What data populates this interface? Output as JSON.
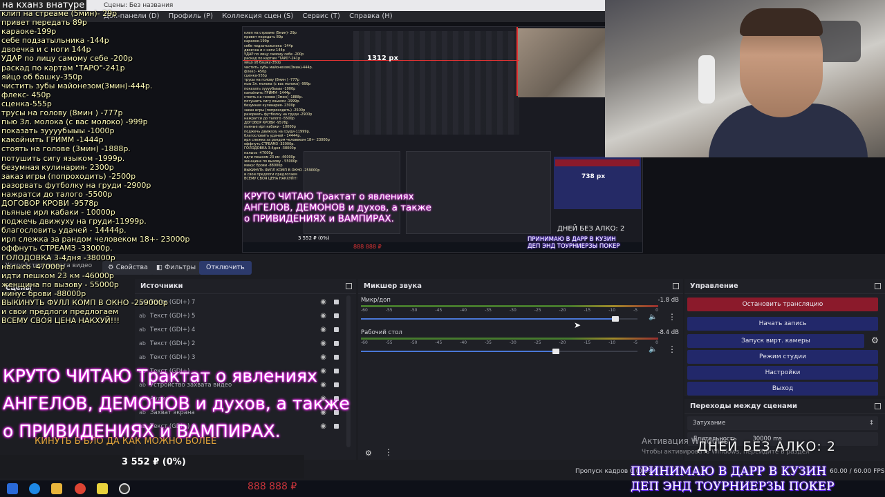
{
  "window": {
    "title": "Сцены: Без названия",
    "menu": [
      "Док-панели (D)",
      "Профиль (P)",
      "Коллекция сцен (S)",
      "Сервис (T)",
      "Справка (H)"
    ]
  },
  "overlay": {
    "title": "на кханз внатуре",
    "price_list": [
      "клип на стреаме (5мин)- 29р",
      "привет передать 89р",
      "караоке-199р",
      "себе подзатыльника -144р",
      "двоечка и с ноги 144р",
      "УДАР по лицу самому себе -200р",
      "раскад по картам \"ТАРО\"-241р",
      "яйцо об башку-350р",
      "чистить зубы майонезом(3мин)-444р.",
      "флекс- 450р",
      "сценка-555р",
      "трусы на голову (8мин ) -777р",
      "пью 3л. молока (с вас молоко) -999р",
      "показать зуууубыыы -1000р",
      "какойнить ГРИММ -1444р",
      "стоять на голове (3мин) -1888р.",
      "потушить сигу языком -1999р.",
      "безумная кулинария- 2300р",
      "заказ игры (попроходить) -2500р",
      "разорвать футболку на груди -2900р",
      "нажратси до талого -5500р",
      "ДОГОВОР КРОВИ -9578р",
      "пьяные ирл кабаки - 10000р",
      "поджечь движуху на груди-11999р.",
      "благословить удачей - 14444р.",
      "ирл слежка за рандом человеком 18+- 23000р",
      "оффнуть СТРЕАМЗ -33000р.",
      "ГОЛОДОВКА 3-4дня -38000р",
      "налысо -47000р",
      "идти пешком 23 км -46000р",
      "женщина по вызову - 55000р",
      "минус брови -88000р",
      "ВЫКИНУТЬ ФУЛЛ КОМП В ОКНО -259000р",
      "и свои предлоги предлогаем",
      "ВСЕМУ СВОЯ ЦЕНА НАКХУЙ!!!"
    ],
    "pink_lines": [
      "КРУТО ЧИТАЮ Трактат о явлениях",
      "АНГЕЛОВ, ДЕМОНОВ и духов, а также",
      "о ПРИВИДЕНИЯХ и ВАМПИРАХ."
    ],
    "goal_text": "КИНУТЬ Б  БЛО ДА КАК МОЖНО БОЛЕЕ",
    "donate_amount": "3 552 ₽ (0%)",
    "rub_888": "888 888 ₽",
    "alko": "ДНЕЙ БЕЗ АЛКО: 2",
    "dar_lines": [
      "ПРИНИМАЮ В ДАРР В КУЗИН",
      "ДЕП ЭНД ТОУРНИЕРЗЫ ПОКЕР"
    ],
    "nested_px_1": "1312 px",
    "nested_px_2": "738 px"
  },
  "toolbar": {
    "props": "Свойства",
    "filters": "Фильтры",
    "disconnect": "Отключить",
    "hidden_device": "Устройство захвата видео"
  },
  "scenes_dock": {
    "title": "Сцены"
  },
  "sources": {
    "title": "Источники",
    "items": [
      {
        "label": "Текст (GDI+) 7"
      },
      {
        "label": "Текст (GDI+) 5"
      },
      {
        "label": "Текст (GDI+) 4"
      },
      {
        "label": "Текст (GDI+) 2"
      },
      {
        "label": "Текст (GDI+) 3"
      },
      {
        "label": "Текст (GDI+)"
      },
      {
        "label": "Устройство захвата видео"
      },
      {
        "label": "Аудио"
      },
      {
        "label": "Захват экрана"
      },
      {
        "label": "Текст (GDI+) 6"
      }
    ]
  },
  "mixer": {
    "title": "Микшер звука",
    "ticks": [
      "-60",
      "-55",
      "-50",
      "-45",
      "-40",
      "-35",
      "-30",
      "-25",
      "-20",
      "-15",
      "-10",
      "-5",
      "0"
    ],
    "channels": [
      {
        "name": "Микр/доп",
        "db": "-1.8 dB",
        "volume": 0.93
      },
      {
        "name": "Рабочий стол",
        "db": "-8.4 dB",
        "volume": 0.71
      }
    ]
  },
  "control": {
    "title": "Управление",
    "stop_stream": "Остановить трансляцию",
    "start_record": "Начать запись",
    "virtual_cam": "Запуск вирт. камеры",
    "studio_mode": "Режим студии",
    "settings": "Настройки",
    "exit": "Выход"
  },
  "transitions": {
    "title": "Переходы между сценами",
    "type": "Затухание",
    "duration_label": "Длительность",
    "duration_value": "30000 ms"
  },
  "status": {
    "dropped_frames": "Пропуск кадров 0 (0.0%)",
    "fps": "60.00 / 60.00 FPS",
    "activation": "Активация Windows",
    "activation_sub": "Чтобы активировать Windows, перейдите в раздел"
  },
  "colors": {
    "stop_red": "#8b1a2b",
    "button_blue": "#22286a",
    "slider_blue": "#4a78d8",
    "pink_glow": "#ff2bff",
    "purple_glow": "#6a2cff"
  }
}
